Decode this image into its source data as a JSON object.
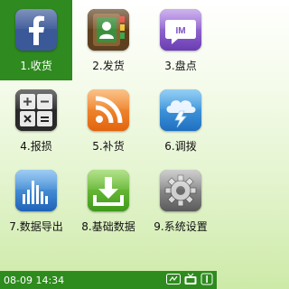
{
  "menu": {
    "items": [
      {
        "label": "1.收货",
        "icon": "facebook-icon",
        "color": "#3b5998",
        "selected": true
      },
      {
        "label": "2.发货",
        "icon": "contacts-book-icon",
        "color": "#5a3a1c",
        "selected": false
      },
      {
        "label": "3.盘点",
        "icon": "im-chat-icon",
        "color": "#8a5bd1",
        "selected": false
      },
      {
        "label": "4.报损",
        "icon": "calculator-icon",
        "color": "#333333",
        "selected": false
      },
      {
        "label": "5.补货",
        "icon": "rss-icon",
        "color": "#f07e1c",
        "selected": false
      },
      {
        "label": "6.调拨",
        "icon": "weather-lightning-icon",
        "color": "#2f8fd8",
        "selected": false
      },
      {
        "label": "7.数据导出",
        "icon": "bar-chart-icon",
        "color": "#2f7fd0",
        "selected": false
      },
      {
        "label": "8.基础数据",
        "icon": "download-icon",
        "color": "#5bb52c",
        "selected": false
      },
      {
        "label": "9.系统设置",
        "icon": "gear-icon",
        "color": "#808080",
        "selected": false
      }
    ]
  },
  "status": {
    "datetime": "08-09 14:34",
    "icons": [
      "network-icon",
      "tv-icon",
      "alert-icon"
    ],
    "bar_color": "#2e8b1e"
  }
}
